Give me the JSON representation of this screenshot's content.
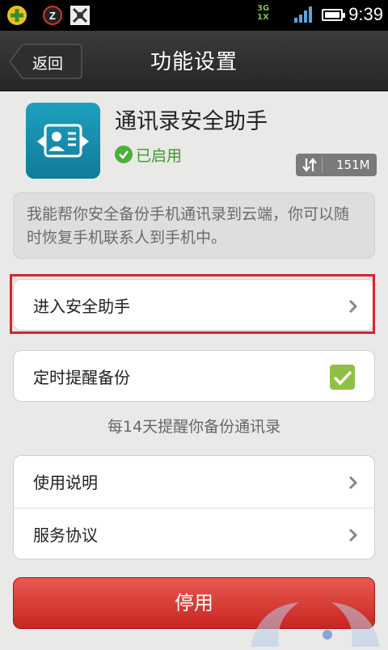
{
  "status_bar": {
    "network_label_top": "3G",
    "network_label_bottom": "1X",
    "time": "9:39"
  },
  "titlebar": {
    "back_label": "返回",
    "title": "功能设置"
  },
  "app": {
    "name": "通讯录安全助手",
    "status_label": "已启用",
    "size": "151M"
  },
  "description": "我能帮你安全备份手机通讯录到云端，你可以随时恢复手机联系人到手机中。",
  "menu": {
    "enter_label": "进入安全助手",
    "backup_reminder_label": "定时提醒备份",
    "backup_reminder_checked": true,
    "hint": "每14天提醒你备份通讯录",
    "instructions_label": "使用说明",
    "agreement_label": "服务协议"
  },
  "stop_button_label": "停用",
  "colors": {
    "accent_red": "#d8232e",
    "check_green": "#8fc045",
    "status_green": "#3a9b2b"
  }
}
